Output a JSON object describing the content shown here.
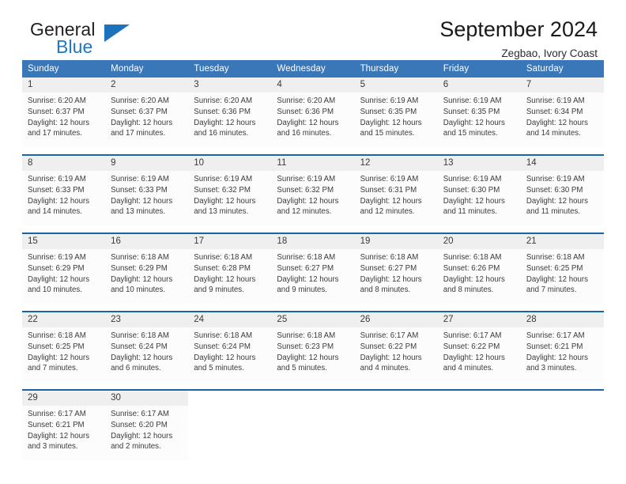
{
  "brand": {
    "name_part1": "General",
    "name_part2": "Blue",
    "triangle_icon": "triangle-logo-icon"
  },
  "header": {
    "title": "September 2024",
    "subtitle": "Zegbao, Ivory Coast"
  },
  "colors": {
    "header_blue": "#3a77b8",
    "separator_blue": "#1963a6",
    "daynum_bg": "#efefef",
    "brand_blue": "#1f76c2"
  },
  "weekdays": [
    "Sunday",
    "Monday",
    "Tuesday",
    "Wednesday",
    "Thursday",
    "Friday",
    "Saturday"
  ],
  "weeks": [
    [
      {
        "day": "1",
        "sunrise": "Sunrise: 6:20 AM",
        "sunset": "Sunset: 6:37 PM",
        "daylight1": "Daylight: 12 hours",
        "daylight2": "and 17 minutes."
      },
      {
        "day": "2",
        "sunrise": "Sunrise: 6:20 AM",
        "sunset": "Sunset: 6:37 PM",
        "daylight1": "Daylight: 12 hours",
        "daylight2": "and 17 minutes."
      },
      {
        "day": "3",
        "sunrise": "Sunrise: 6:20 AM",
        "sunset": "Sunset: 6:36 PM",
        "daylight1": "Daylight: 12 hours",
        "daylight2": "and 16 minutes."
      },
      {
        "day": "4",
        "sunrise": "Sunrise: 6:20 AM",
        "sunset": "Sunset: 6:36 PM",
        "daylight1": "Daylight: 12 hours",
        "daylight2": "and 16 minutes."
      },
      {
        "day": "5",
        "sunrise": "Sunrise: 6:19 AM",
        "sunset": "Sunset: 6:35 PM",
        "daylight1": "Daylight: 12 hours",
        "daylight2": "and 15 minutes."
      },
      {
        "day": "6",
        "sunrise": "Sunrise: 6:19 AM",
        "sunset": "Sunset: 6:35 PM",
        "daylight1": "Daylight: 12 hours",
        "daylight2": "and 15 minutes."
      },
      {
        "day": "7",
        "sunrise": "Sunrise: 6:19 AM",
        "sunset": "Sunset: 6:34 PM",
        "daylight1": "Daylight: 12 hours",
        "daylight2": "and 14 minutes."
      }
    ],
    [
      {
        "day": "8",
        "sunrise": "Sunrise: 6:19 AM",
        "sunset": "Sunset: 6:33 PM",
        "daylight1": "Daylight: 12 hours",
        "daylight2": "and 14 minutes."
      },
      {
        "day": "9",
        "sunrise": "Sunrise: 6:19 AM",
        "sunset": "Sunset: 6:33 PM",
        "daylight1": "Daylight: 12 hours",
        "daylight2": "and 13 minutes."
      },
      {
        "day": "10",
        "sunrise": "Sunrise: 6:19 AM",
        "sunset": "Sunset: 6:32 PM",
        "daylight1": "Daylight: 12 hours",
        "daylight2": "and 13 minutes."
      },
      {
        "day": "11",
        "sunrise": "Sunrise: 6:19 AM",
        "sunset": "Sunset: 6:32 PM",
        "daylight1": "Daylight: 12 hours",
        "daylight2": "and 12 minutes."
      },
      {
        "day": "12",
        "sunrise": "Sunrise: 6:19 AM",
        "sunset": "Sunset: 6:31 PM",
        "daylight1": "Daylight: 12 hours",
        "daylight2": "and 12 minutes."
      },
      {
        "day": "13",
        "sunrise": "Sunrise: 6:19 AM",
        "sunset": "Sunset: 6:30 PM",
        "daylight1": "Daylight: 12 hours",
        "daylight2": "and 11 minutes."
      },
      {
        "day": "14",
        "sunrise": "Sunrise: 6:19 AM",
        "sunset": "Sunset: 6:30 PM",
        "daylight1": "Daylight: 12 hours",
        "daylight2": "and 11 minutes."
      }
    ],
    [
      {
        "day": "15",
        "sunrise": "Sunrise: 6:19 AM",
        "sunset": "Sunset: 6:29 PM",
        "daylight1": "Daylight: 12 hours",
        "daylight2": "and 10 minutes."
      },
      {
        "day": "16",
        "sunrise": "Sunrise: 6:18 AM",
        "sunset": "Sunset: 6:29 PM",
        "daylight1": "Daylight: 12 hours",
        "daylight2": "and 10 minutes."
      },
      {
        "day": "17",
        "sunrise": "Sunrise: 6:18 AM",
        "sunset": "Sunset: 6:28 PM",
        "daylight1": "Daylight: 12 hours",
        "daylight2": "and 9 minutes."
      },
      {
        "day": "18",
        "sunrise": "Sunrise: 6:18 AM",
        "sunset": "Sunset: 6:27 PM",
        "daylight1": "Daylight: 12 hours",
        "daylight2": "and 9 minutes."
      },
      {
        "day": "19",
        "sunrise": "Sunrise: 6:18 AM",
        "sunset": "Sunset: 6:27 PM",
        "daylight1": "Daylight: 12 hours",
        "daylight2": "and 8 minutes."
      },
      {
        "day": "20",
        "sunrise": "Sunrise: 6:18 AM",
        "sunset": "Sunset: 6:26 PM",
        "daylight1": "Daylight: 12 hours",
        "daylight2": "and 8 minutes."
      },
      {
        "day": "21",
        "sunrise": "Sunrise: 6:18 AM",
        "sunset": "Sunset: 6:25 PM",
        "daylight1": "Daylight: 12 hours",
        "daylight2": "and 7 minutes."
      }
    ],
    [
      {
        "day": "22",
        "sunrise": "Sunrise: 6:18 AM",
        "sunset": "Sunset: 6:25 PM",
        "daylight1": "Daylight: 12 hours",
        "daylight2": "and 7 minutes."
      },
      {
        "day": "23",
        "sunrise": "Sunrise: 6:18 AM",
        "sunset": "Sunset: 6:24 PM",
        "daylight1": "Daylight: 12 hours",
        "daylight2": "and 6 minutes."
      },
      {
        "day": "24",
        "sunrise": "Sunrise: 6:18 AM",
        "sunset": "Sunset: 6:24 PM",
        "daylight1": "Daylight: 12 hours",
        "daylight2": "and 5 minutes."
      },
      {
        "day": "25",
        "sunrise": "Sunrise: 6:18 AM",
        "sunset": "Sunset: 6:23 PM",
        "daylight1": "Daylight: 12 hours",
        "daylight2": "and 5 minutes."
      },
      {
        "day": "26",
        "sunrise": "Sunrise: 6:17 AM",
        "sunset": "Sunset: 6:22 PM",
        "daylight1": "Daylight: 12 hours",
        "daylight2": "and 4 minutes."
      },
      {
        "day": "27",
        "sunrise": "Sunrise: 6:17 AM",
        "sunset": "Sunset: 6:22 PM",
        "daylight1": "Daylight: 12 hours",
        "daylight2": "and 4 minutes."
      },
      {
        "day": "28",
        "sunrise": "Sunrise: 6:17 AM",
        "sunset": "Sunset: 6:21 PM",
        "daylight1": "Daylight: 12 hours",
        "daylight2": "and 3 minutes."
      }
    ],
    [
      {
        "day": "29",
        "sunrise": "Sunrise: 6:17 AM",
        "sunset": "Sunset: 6:21 PM",
        "daylight1": "Daylight: 12 hours",
        "daylight2": "and 3 minutes."
      },
      {
        "day": "30",
        "sunrise": "Sunrise: 6:17 AM",
        "sunset": "Sunset: 6:20 PM",
        "daylight1": "Daylight: 12 hours",
        "daylight2": "and 2 minutes."
      },
      null,
      null,
      null,
      null,
      null
    ]
  ]
}
